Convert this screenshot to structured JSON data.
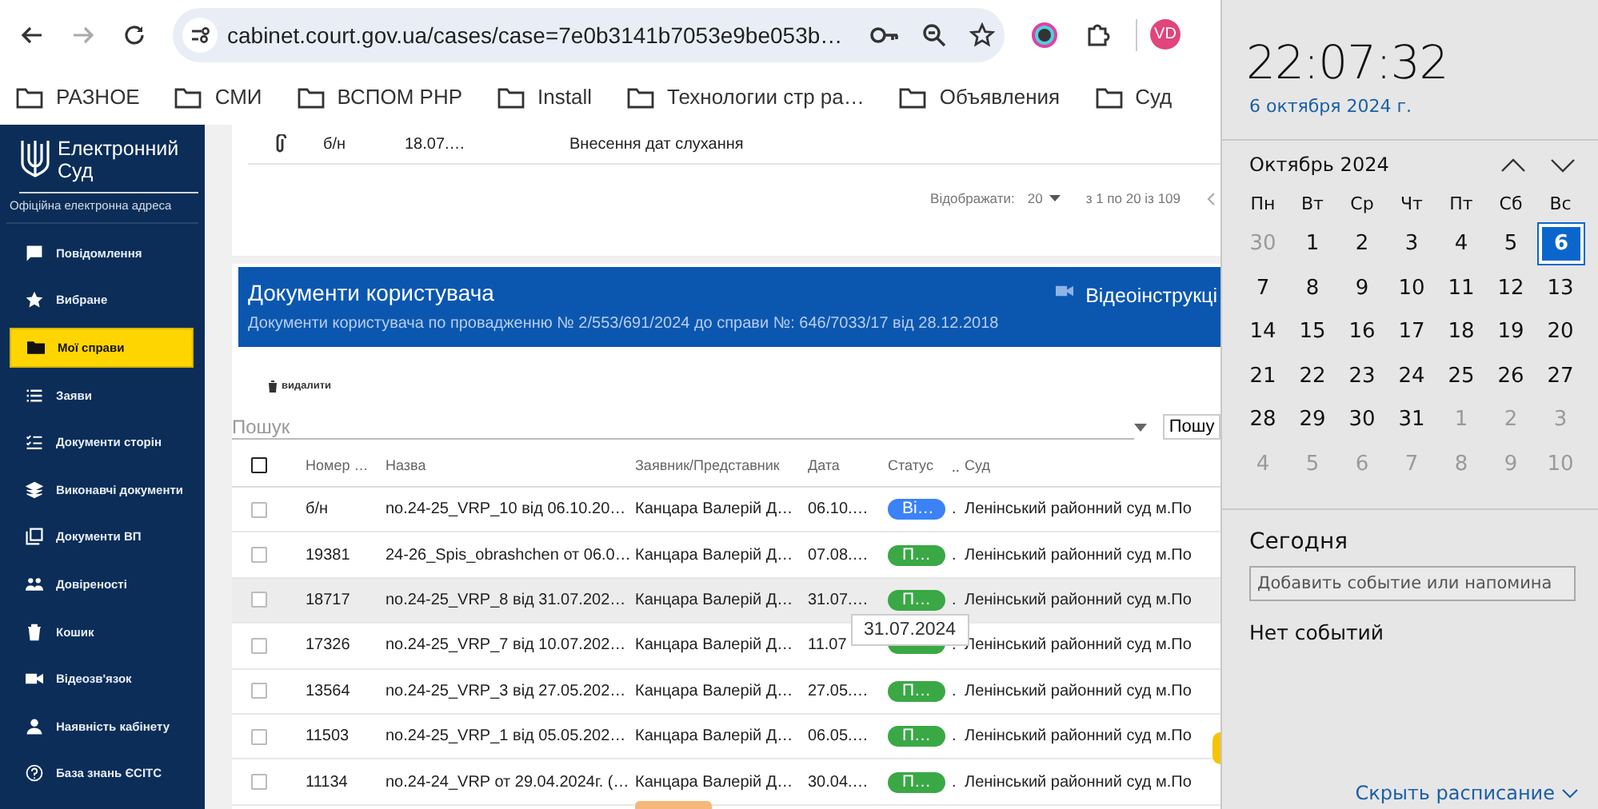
{
  "browser": {
    "address": "cabinet.court.gov.ua/cases/case=7e0b3141b7053e9be053b…",
    "avatar": "VD",
    "bookmarks": [
      "РАЗНОЕ",
      "СМИ",
      "ВСПОМ PHP",
      "Install",
      "Технологии стр ра…",
      "Объявления",
      "Суд"
    ]
  },
  "sidebar": {
    "title": "Електронний Суд",
    "subtitle": "Офіційна електронна адреса",
    "items": [
      {
        "label": "Повідомлення",
        "selected": false
      },
      {
        "label": "Вибране",
        "selected": false
      },
      {
        "label": "Мої справи",
        "selected": true
      },
      {
        "label": "Заяви",
        "selected": false
      },
      {
        "label": "Документи сторін",
        "selected": false
      },
      {
        "label": "Виконавчі документи",
        "selected": false
      },
      {
        "label": "Документи ВП",
        "selected": false
      },
      {
        "label": "Довіреності",
        "selected": false
      },
      {
        "label": "Кошик",
        "selected": false
      },
      {
        "label": "Відеозв'язок",
        "selected": false
      },
      {
        "label": "Наявність кабінету",
        "selected": false
      },
      {
        "label": "База знань ЄСІТС",
        "selected": false
      }
    ]
  },
  "previous_table": {
    "row": {
      "number": "б/н",
      "date": "18.07.…",
      "name": "Внесення дат слухання"
    },
    "pagination": {
      "label": "Відображати:",
      "page_size": "20",
      "range": "з 1 по 20 із 109"
    }
  },
  "panel": {
    "title": "Документи користувача",
    "subtitle": "Документи користувача по провадженню № 2/553/691/2024 до справи №: 646/7033/17 від 28.12.2018",
    "video_link": "Відеоінструкці"
  },
  "toolbar": {
    "delete": "видалити"
  },
  "search": {
    "placeholder": "Пошук",
    "dropdown": "Пошу"
  },
  "table": {
    "header_checked": false,
    "columns": [
      "Номер …",
      "Назва",
      "Заявник/Представник",
      "Дата",
      "Статус",
      "‥",
      "Суд"
    ],
    "rows": [
      {
        "checked": false,
        "hovered": false,
        "cells": [
          "б/н",
          "no.24-25_VRP_10 від 06.10.20…",
          "Канцара Валерій Д…",
          "06.10.…"
        ],
        "status": {
          "label": "Ві…",
          "color": "#3b82f6"
        },
        "mark": ".",
        "court": "Ленінський районний суд м.По"
      },
      {
        "checked": false,
        "hovered": false,
        "cells": [
          "19381",
          "24-26_Spis_obrashchen от 06.0…",
          "Канцара Валерій Д…",
          "07.08.…"
        ],
        "status": {
          "label": "П…",
          "color": "#3aa845"
        },
        "mark": ".",
        "court": "Ленінський районний суд м.По"
      },
      {
        "checked": false,
        "hovered": true,
        "cells": [
          "18717",
          "no.24-25_VRP_8 від 31.07.202…",
          "Канцара Валерій Д…",
          "31.07.…"
        ],
        "status": {
          "label": "П…",
          "color": "#3aa845"
        },
        "mark": ".",
        "court": "Ленінський районний суд м.По"
      },
      {
        "checked": false,
        "hovered": false,
        "cells": [
          "17326",
          "no.24-25_VRP_7 від 10.07.202…",
          "Канцара Валерій Д…",
          "11.07"
        ],
        "status": {
          "color": "#3aa845"
        },
        "mark": ".",
        "court": "Ленінський районний суд м.По"
      },
      {
        "checked": false,
        "hovered": false,
        "cells": [
          "13564",
          "no.24-25_VRP_3 від 27.05.202…",
          "Канцара Валерій Д…",
          "27.05.…"
        ],
        "status": {
          "label": "П…",
          "color": "#3aa845"
        },
        "mark": ".",
        "court": "Ленінський районний суд м.По"
      },
      {
        "checked": false,
        "hovered": false,
        "cells": [
          "11503",
          "no.24-25_VRP_1 від 05.05.202…",
          "Канцара Валерій Д…",
          "06.05.…"
        ],
        "status": {
          "label": "П…",
          "color": "#3aa845"
        },
        "mark": ".",
        "court": "Ленінський районний суд м.По"
      },
      {
        "checked": false,
        "hovered": false,
        "cells": [
          "11134",
          "no.24-24_VRP от 29.04.2024г. (…",
          "Канцара Валерій Д…",
          "30.04.…"
        ],
        "status": {
          "label": "П…",
          "color": "#3aa845"
        },
        "mark": ".",
        "court": "Ленінський районний суд м.По"
      }
    ]
  },
  "tooltip": "31.07.2024",
  "calendar": {
    "time": "22:07:32",
    "date": "6 октября 2024 г.",
    "month": "Октябрь 2024",
    "weekdays": [
      "Пн",
      "Вт",
      "Ср",
      "Чт",
      "Пт",
      "Сб",
      "Вс"
    ],
    "days": [
      {
        "label": "30",
        "muted": true,
        "selected": false
      },
      {
        "label": "1",
        "muted": false,
        "selected": false
      },
      {
        "label": "2",
        "muted": false,
        "selected": false
      },
      {
        "label": "3",
        "muted": false,
        "selected": false
      },
      {
        "label": "4",
        "muted": false,
        "selected": false
      },
      {
        "label": "5",
        "muted": false,
        "selected": false
      },
      {
        "label": "6",
        "muted": false,
        "selected": true
      },
      {
        "label": "7",
        "muted": false,
        "selected": false
      },
      {
        "label": "8",
        "muted": false,
        "selected": false
      },
      {
        "label": "9",
        "muted": false,
        "selected": false
      },
      {
        "label": "10",
        "muted": false,
        "selected": false
      },
      {
        "label": "11",
        "muted": false,
        "selected": false
      },
      {
        "label": "12",
        "muted": false,
        "selected": false
      },
      {
        "label": "13",
        "muted": false,
        "selected": false
      },
      {
        "label": "14",
        "muted": false,
        "selected": false
      },
      {
        "label": "15",
        "muted": false,
        "selected": false
      },
      {
        "label": "16",
        "muted": false,
        "selected": false
      },
      {
        "label": "17",
        "muted": false,
        "selected": false
      },
      {
        "label": "18",
        "muted": false,
        "selected": false
      },
      {
        "label": "19",
        "muted": false,
        "selected": false
      },
      {
        "label": "20",
        "muted": false,
        "selected": false
      },
      {
        "label": "21",
        "muted": false,
        "selected": false
      },
      {
        "label": "22",
        "muted": false,
        "selected": false
      },
      {
        "label": "23",
        "muted": false,
        "selected": false
      },
      {
        "label": "24",
        "muted": false,
        "selected": false
      },
      {
        "label": "25",
        "muted": false,
        "selected": false
      },
      {
        "label": "26",
        "muted": false,
        "selected": false
      },
      {
        "label": "27",
        "muted": false,
        "selected": false
      },
      {
        "label": "28",
        "muted": false,
        "selected": false
      },
      {
        "label": "29",
        "muted": false,
        "selected": false
      },
      {
        "label": "30",
        "muted": false,
        "selected": false
      },
      {
        "label": "31",
        "muted": false,
        "selected": false
      },
      {
        "label": "1",
        "muted": true,
        "selected": false
      },
      {
        "label": "2",
        "muted": true,
        "selected": false
      },
      {
        "label": "3",
        "muted": true,
        "selected": false
      },
      {
        "label": "4",
        "muted": true,
        "selected": false
      },
      {
        "label": "5",
        "muted": true,
        "selected": false
      },
      {
        "label": "6",
        "muted": true,
        "selected": false
      },
      {
        "label": "7",
        "muted": true,
        "selected": false
      },
      {
        "label": "8",
        "muted": true,
        "selected": false
      },
      {
        "label": "9",
        "muted": true,
        "selected": false
      },
      {
        "label": "10",
        "muted": true,
        "selected": false
      }
    ],
    "today_label": "Сегодня",
    "event_placeholder": "Добавить событие или напомина",
    "no_events": "Нет событий",
    "hide_link": "Скрыть расписание"
  }
}
